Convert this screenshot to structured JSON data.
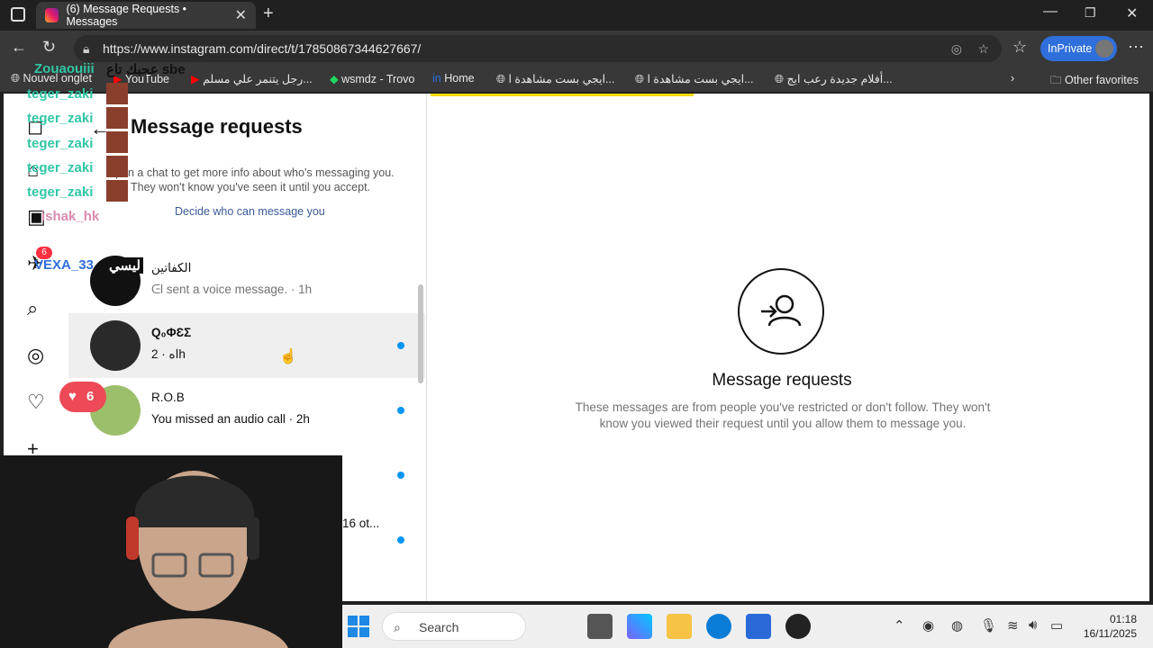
{
  "browser": {
    "tab_title": "(6) Message Requests • Messages",
    "url": "https://www.instagram.com/direct/t/17850867344627667/",
    "inprivate_label": "InPrivate",
    "favorites": [
      {
        "label": "Nouvel onglet"
      },
      {
        "label": "YouTube"
      },
      {
        "label": "رجل يتنمر علي مسلم..."
      },
      {
        "label": "wsmdz - Trovo"
      },
      {
        "label": "Home"
      },
      {
        "label": "ايجي بست مشاهدة ا..."
      },
      {
        "label": "ايجي بست مشاهدة ا..."
      },
      {
        "label": "أفلام جديدة رعب ايج..."
      }
    ],
    "other_favorites": "Other favorites"
  },
  "instagram": {
    "badge_count": "6",
    "requests_panel": {
      "title": "Message requests",
      "subtitle": "Open a chat to get more info about who's messaging you. They won't know you've seen it until you accept.",
      "decide_link": "Decide who can message you"
    },
    "threads": [
      {
        "name": "الكفاتين",
        "preview": "ᕮl sent a voice message. · 1h",
        "unread": false,
        "selected": false
      },
      {
        "name": "Q₀ΦƐΣ",
        "preview": "اه · 2h",
        "unread": true,
        "selected": true
      },
      {
        "name": "R.O.B",
        "preview": "You missed an audio call · 2h",
        "unread": true,
        "selected": false
      },
      {
        "name": "",
        "preview": "",
        "unread": true,
        "selected": false
      },
      {
        "name": "",
        "preview": "16 ot...",
        "unread": true,
        "selected": false
      }
    ],
    "detail": {
      "title": "Message requests",
      "subtitle": "These messages are from people you've restricted or don't follow. They won't know you viewed their request until you allow them to message you."
    }
  },
  "overlay": {
    "chat": [
      {
        "user": "Zouaouiii",
        "text": "عجبك تاع sbe"
      },
      {
        "user": "teger_zaki",
        "text": ""
      },
      {
        "user": "teger_zaki",
        "text": ""
      },
      {
        "user": "teger_zaki",
        "text": ""
      },
      {
        "user": "teger_zaki",
        "text": ""
      },
      {
        "user": "teger_zaki",
        "text": ""
      },
      {
        "user": "ishak_hk",
        "text": ""
      },
      {
        "user": "VEXA_33",
        "text": "ليسي"
      }
    ],
    "heart_count": "6"
  },
  "taskbar": {
    "search_label": "Search",
    "time": "01:18",
    "date": "16/11/2025"
  }
}
